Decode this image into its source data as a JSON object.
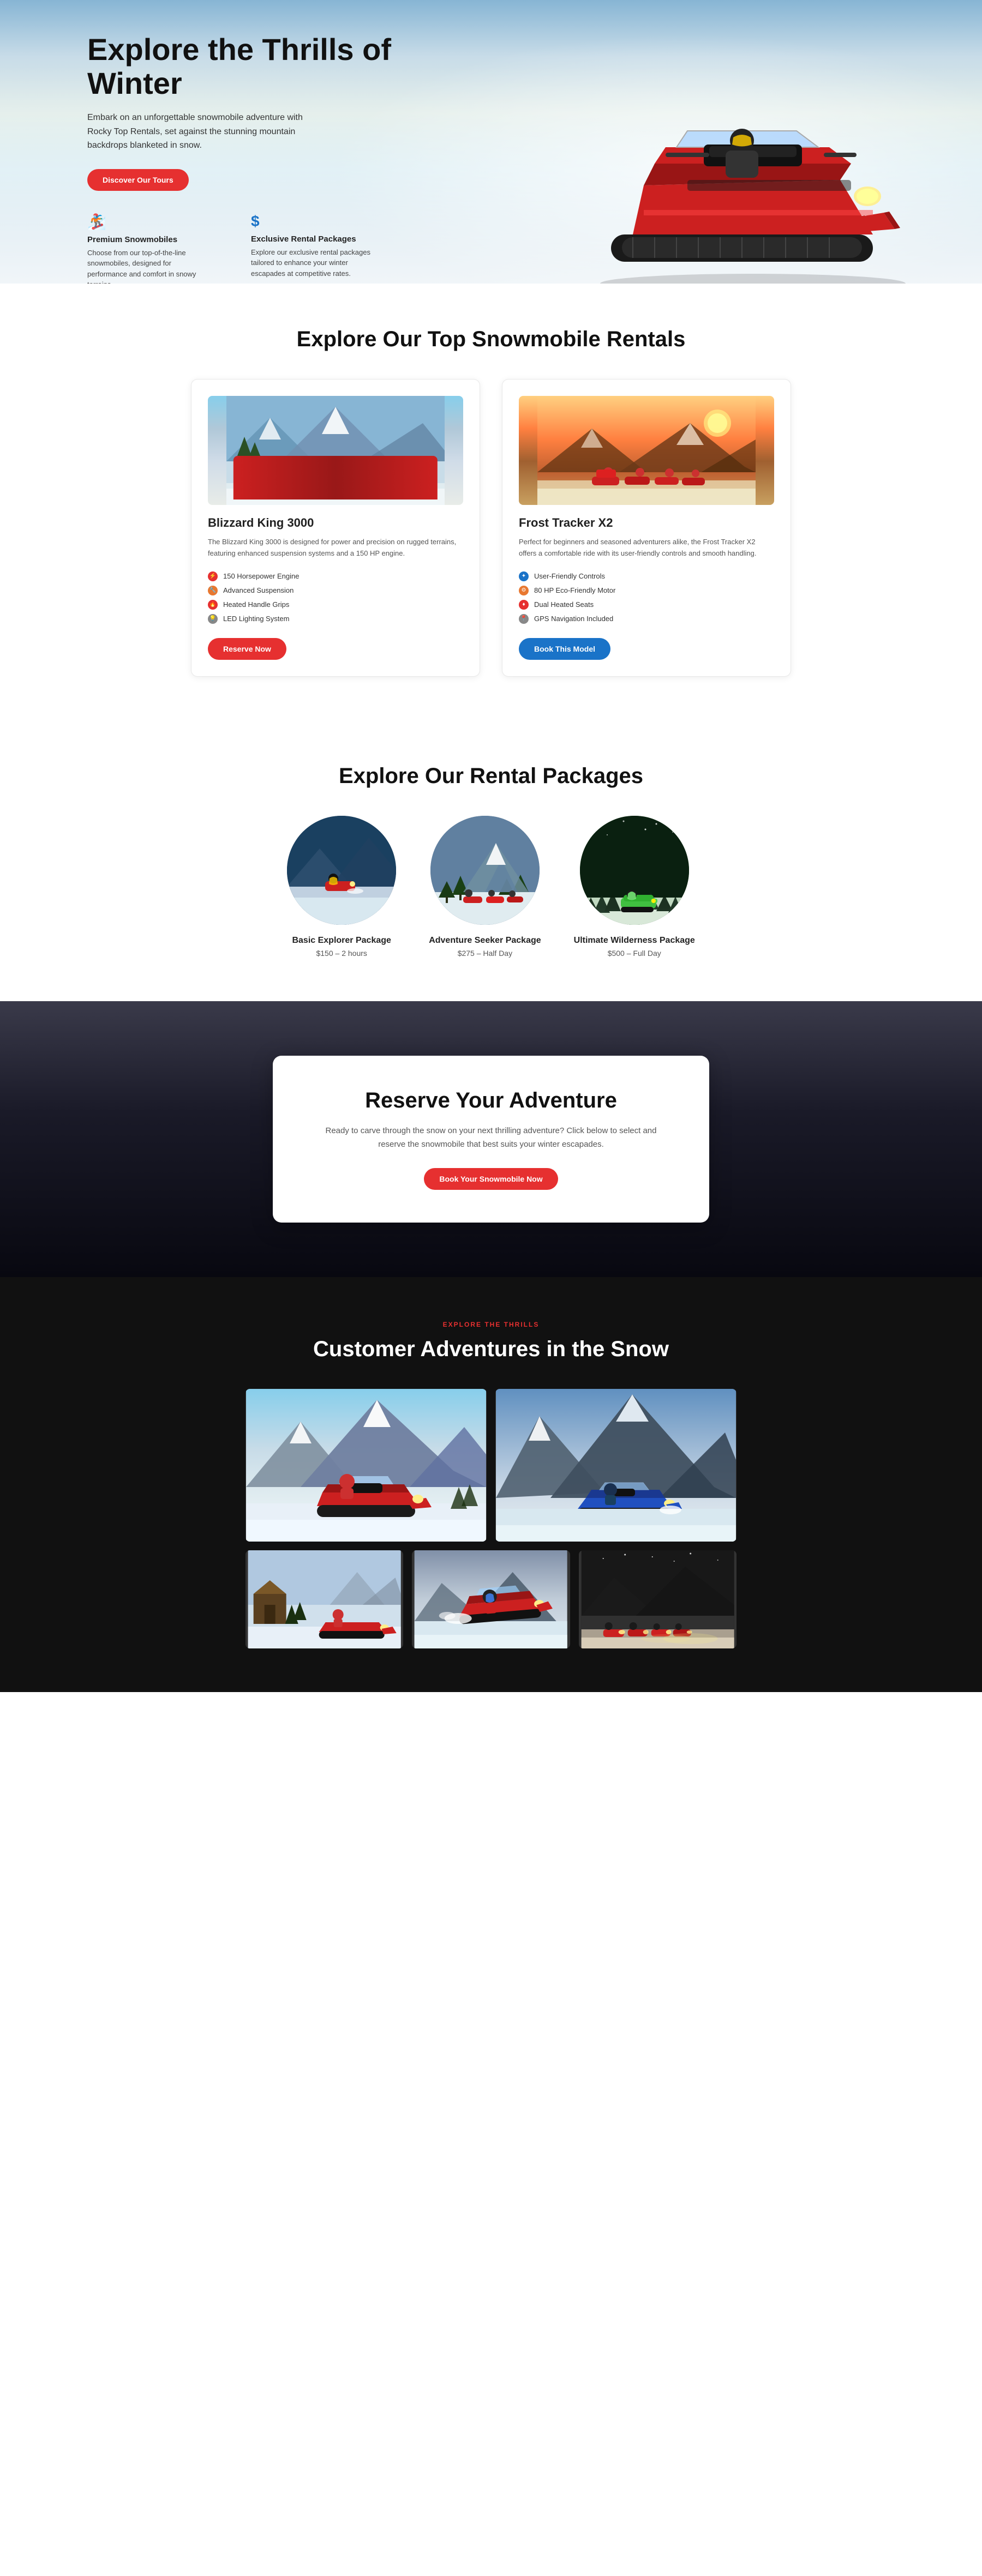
{
  "hero": {
    "title": "Explore the Thrills of Winter",
    "subtitle": "Embark on an unforgettable snowmobile adventure with Rocky Top Rentals, set against the stunning mountain backdrops blanketed in snow.",
    "cta_label": "Discover Our Tours",
    "feature1": {
      "icon": "🏂",
      "title": "Premium Snowmobiles",
      "desc": "Choose from our top-of-the-line snowmobiles, designed for performance and comfort in snowy terrains."
    },
    "feature2": {
      "icon": "$",
      "title": "Exclusive Rental Packages",
      "desc": "Explore our exclusive rental packages tailored to enhance your winter escapades at competitive rates."
    }
  },
  "rentals_section": {
    "title": "Explore Our Top Snowmobile Rentals",
    "card1": {
      "name": "Blizzard King 3000",
      "desc": "The Blizzard King 3000 is designed for power and precision on rugged terrains, featuring enhanced suspension systems and a 150 HP engine.",
      "features": [
        "150 Horsepower Engine",
        "Advanced Suspension",
        "Heated Handle Grips",
        "LED Lighting System"
      ],
      "cta": "Reserve Now"
    },
    "card2": {
      "name": "Frost Tracker X2",
      "desc": "Perfect for beginners and seasoned adventurers alike, the Frost Tracker X2 offers a comfortable ride with its user-friendly controls and smooth handling.",
      "features": [
        "User-Friendly Controls",
        "80 HP Eco-Friendly Motor",
        "Dual Heated Seats",
        "GPS Navigation Included"
      ],
      "cta": "Book This Model"
    }
  },
  "packages_section": {
    "title": "Explore Our Rental Packages",
    "packages": [
      {
        "name": "Basic Explorer Package",
        "price": "$150 – 2 hours"
      },
      {
        "name": "Adventure Seeker Package",
        "price": "$275 – Half Day"
      },
      {
        "name": "Ultimate Wilderness Package",
        "price": "$500 – Full Day"
      }
    ]
  },
  "reserve_section": {
    "title": "Reserve Your Adventure",
    "desc": "Ready to carve through the snow on your next thrilling adventure? Click below to select and reserve the snowmobile that best suits your winter escapades.",
    "cta": "Book Your Snowmobile Now"
  },
  "adventures_section": {
    "tag": "EXPLORE THE THRILLS",
    "title": "Customer Adventures in the Snow"
  }
}
